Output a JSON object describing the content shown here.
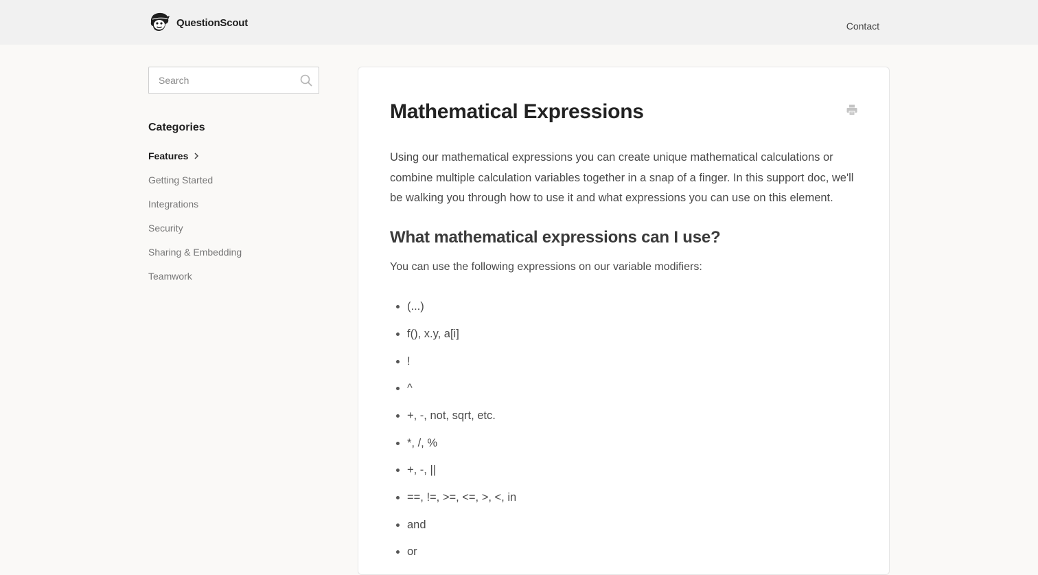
{
  "header": {
    "brand_name": "QuestionScout",
    "contact_label": "Contact"
  },
  "sidebar": {
    "search": {
      "placeholder": "Search"
    },
    "categories_heading": "Categories",
    "categories": [
      {
        "label": "Features",
        "active": true
      },
      {
        "label": "Getting Started",
        "active": false
      },
      {
        "label": "Integrations",
        "active": false
      },
      {
        "label": "Security",
        "active": false
      },
      {
        "label": "Sharing & Embedding",
        "active": false
      },
      {
        "label": "Teamwork",
        "active": false
      }
    ]
  },
  "article": {
    "title": "Mathematical Expressions",
    "intro": "Using our mathematical expressions you can create unique mathematical calculations or combine multiple calculation variables together in a snap of a finger. In this support doc, we'll be walking you through how to use it and what expressions you can use on this element.",
    "subheading": "What mathematical expressions can I use?",
    "lead": "You can use the following expressions on our variable modifiers:",
    "expressions": [
      "(...)",
      "f(), x.y, a[i]",
      "!",
      "^",
      "+, -, not, sqrt, etc.",
      "*, /, %",
      "+, -, ||",
      "==, !=, >=, <=, >, <, in",
      "and",
      "or"
    ]
  },
  "icons": {
    "logo": "mascot-logo-icon",
    "search": "search-icon",
    "chevron": "chevron-right-icon",
    "print": "printer-icon"
  }
}
